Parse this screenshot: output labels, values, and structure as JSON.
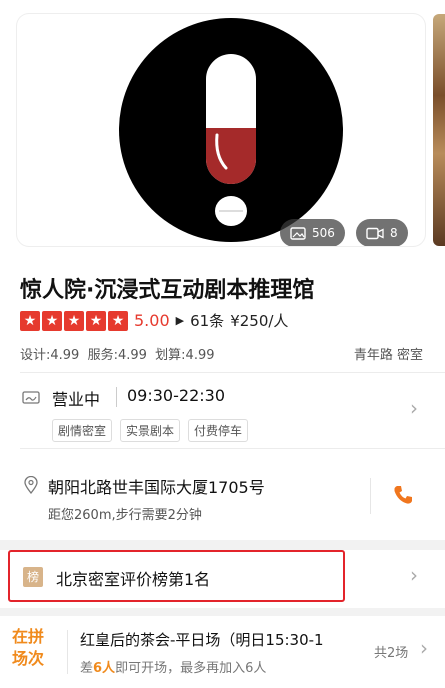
{
  "gallery": {
    "photo_count": "506",
    "video_count": "8"
  },
  "store": {
    "name": "惊人院·沉浸式互动剧本推理馆",
    "score": "5.00",
    "reviews": "61条",
    "price": "¥250/人",
    "sub_scores": "设计:4.99  服务:4.99  划算:4.99",
    "area": "青年路 密室"
  },
  "hours": {
    "status": "营业中",
    "time": "09:30-22:30",
    "tags": [
      "剧情密室",
      "实景剧本",
      "付费停车"
    ]
  },
  "address": {
    "text": "朝阳北路世丰国际大厦1705号",
    "distance": "距您260m,步行需要2分钟"
  },
  "rank": {
    "tag": "榜",
    "text": "北京密室评价榜第1名"
  },
  "group": {
    "logo_line1": "在拼",
    "logo_line2": "场次",
    "title": "红皇后的茶会-平日场（明日15:30-1",
    "sub_prefix": "差",
    "sub_highlight": "6人",
    "sub_suffix": "即可开场，最多再加入6人",
    "count": "共2场"
  }
}
